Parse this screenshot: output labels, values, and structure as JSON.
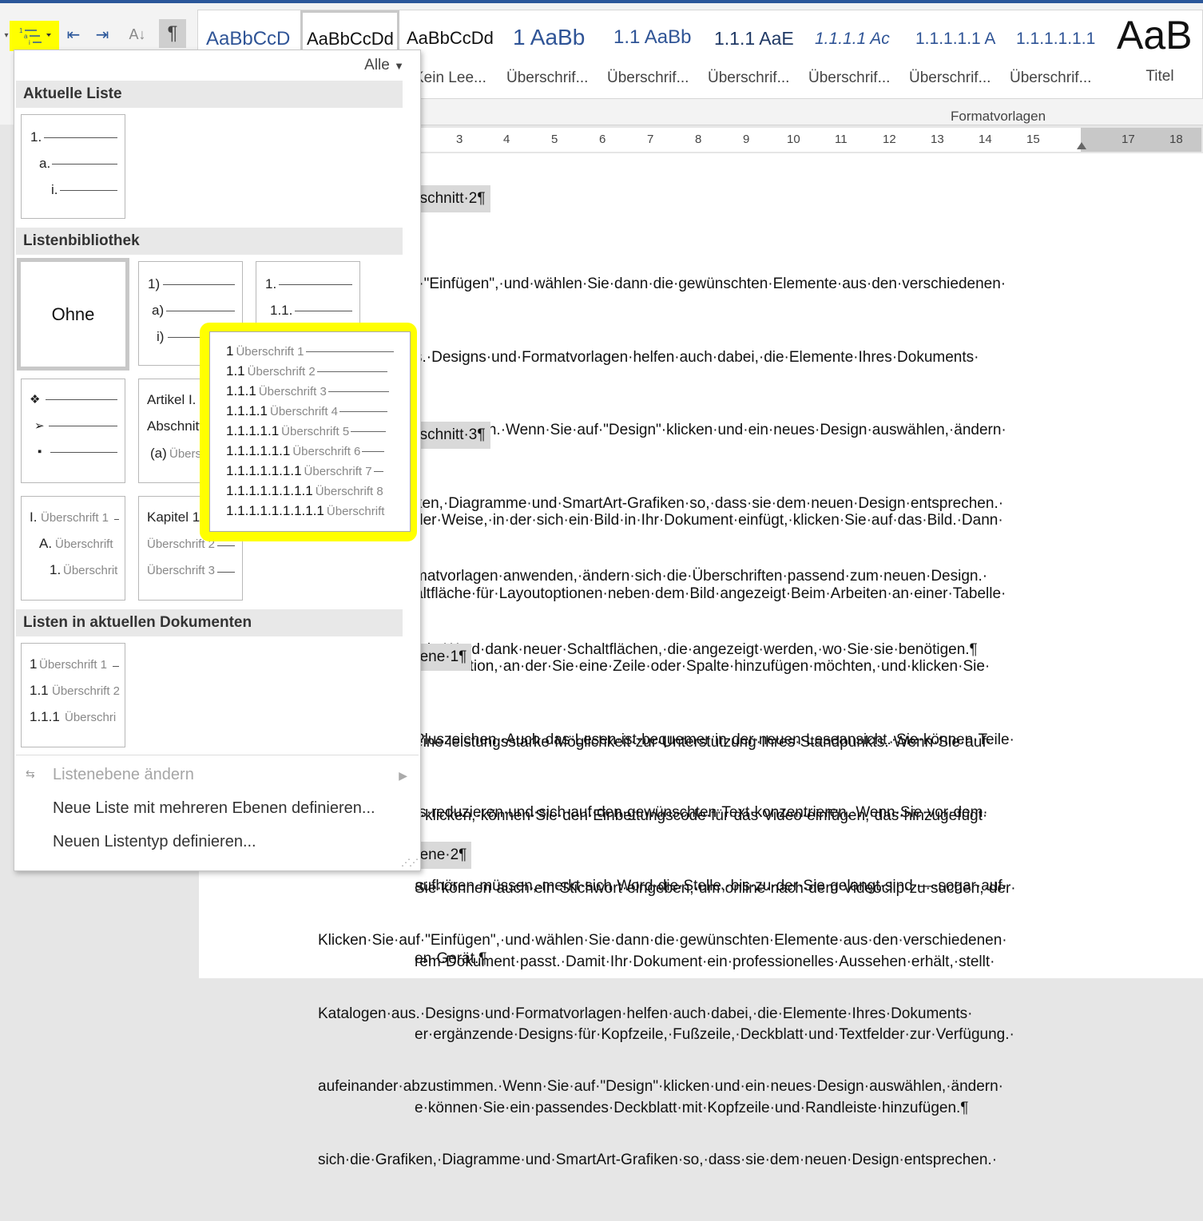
{
  "ribbon": {
    "multilevel_list_icon": "multilevel-list-icon",
    "pilcrow": "¶",
    "styles": [
      {
        "preview": "AaBbCcD",
        "name": ""
      },
      {
        "preview": "AaBbCcDd",
        "name": "Kein Lee..."
      },
      {
        "preview": "AaBbCcDd",
        "name": "Überschrif..."
      },
      {
        "preview": "1  AaBb",
        "name": "Überschrif..."
      },
      {
        "preview": "1.1  AaBb",
        "name": "Überschrif..."
      },
      {
        "preview": "1.1.1  AaE",
        "name": "Überschrif..."
      },
      {
        "preview": "1.1.1.1  Ac",
        "name": "Überschrif..."
      },
      {
        "preview": "1.1.1.1.1  A",
        "name": "Überschrif..."
      },
      {
        "preview": "1.1.1.1.1.1",
        "name": ""
      },
      {
        "preview": "AaB",
        "name": "Titel"
      }
    ],
    "group_label": "Formatvorlagen"
  },
  "ruler": {
    "ticks": [
      "3",
      "4",
      "5",
      "6",
      "7",
      "8",
      "9",
      "10",
      "11",
      "12",
      "13",
      "14",
      "15",
      "17",
      "18"
    ]
  },
  "dropdown": {
    "filter_label": "Alle",
    "sections": {
      "current": "Aktuelle Liste",
      "library": "Listenbibliothek",
      "recent": "Listen in aktuellen Dokumenten"
    },
    "current_list": [
      "1.",
      "a.",
      "i."
    ],
    "library": {
      "none_label": "Ohne",
      "paren": [
        "1)",
        "a)",
        "i)"
      ],
      "decimal": [
        "1.",
        "1.1.",
        "1.1.1."
      ],
      "bullets": [
        "❖",
        "➢",
        "▪"
      ],
      "article": [
        "Artikel I.",
        "Abschnitt",
        "(a)",
        "Übers"
      ],
      "roman_headings": [
        "I.",
        "Überschrift 1",
        "A.",
        "Überschrift",
        "1.",
        "Überschrit"
      ],
      "chapter": [
        "Kapitel 1",
        "Überschrift 2",
        "Überschrift 3"
      ]
    },
    "recent_list": [
      "1",
      "Überschrift 1",
      "1.1",
      "Überschrift 2",
      "1.1.1",
      "Überschri"
    ],
    "menu": {
      "change_level": "Listenebene ändern",
      "define_multilevel": "Neue Liste mit mehreren Ebenen definieren...",
      "define_style": "Neuen Listentyp definieren..."
    }
  },
  "preview_list": [
    {
      "num": "1",
      "label": "Überschrift 1"
    },
    {
      "num": "1.1",
      "label": "Überschrift 2"
    },
    {
      "num": "1.1.1",
      "label": "Überschrift 3"
    },
    {
      "num": "1.1.1.1",
      "label": "Überschrift 4"
    },
    {
      "num": "1.1.1.1.1",
      "label": "Überschrift 5"
    },
    {
      "num": "1.1.1.1.1.1",
      "label": "Überschrift 6"
    },
    {
      "num": "1.1.1.1.1.1.1",
      "label": "Überschrift 7"
    },
    {
      "num": "1.1.1.1.1.1.1.1",
      "label": "Überschrift 8"
    },
    {
      "num": "1.1.1.1.1.1.1.1.1",
      "label": "Überschrift"
    }
  ],
  "document": {
    "h1": "bschnitt·2¶",
    "p1": [
      "f·\"Einfügen\",·und·wählen·Sie·dann·die·gewünschten·Elemente·aus·den·verschiedenen·",
      "s.·Designs·und·Formatvorlagen·helfen·auch·dabei,·die·Elemente·Ihres·Dokuments·",
      "bzustimmen.·Wenn·Sie·auf·\"Design\"·klicken·und·ein·neues·Design·auswählen,·ändern·",
      "ken,·Diagramme·und·SmartArt-Grafiken·so,·dass·sie·dem·neuen·Design·entsprechen.·",
      "matvorlagen·anwenden,·ändern·sich·die·Überschriften·passend·zum·neuen·Design.·",
      "it·in·Word·dank·neuer·Schaltflächen,·die·angezeigt·werden,·wo·Sie·sie·benötigen.¶"
    ],
    "h2": "bschnitt·3¶",
    "p2": [
      "der·Weise,·in·der·sich·ein·Bild·in·Ihr·Dokument·einfügt,·klicken·Sie·auf·das·Bild.·Dann·",
      "altfläche·für·Layoutoptionen·neben·dem·Bild·angezeigt·Beim·Arbeiten·an·einer·Tabelle·",
      "die·Position,·an·der·Sie·eine·Zeile·oder·Spalte·hinzufügen·möchten,·und·klicken·Sie·",
      "Pluszeichen.·Auch·das·Lesen·ist·bequemer·in·der·neuen·Leseansicht.·Sie·können·Teile·",
      "ts·reduzieren·und·sich·auf·den·gewünschten·Text·konzentrieren.·Wenn·Sie·vor·dem·",
      "aufhören·müssen,·merkt·sich·Word·die·Stelle,·bis·zu·der·Sie·gelangt·sind·—·sogar·auf·",
      "en·Gerät.¶"
    ],
    "h3": "bene·1¶",
    "p3": [
      "eine·leistungsstarke·Möglichkeit·zur·Unterstützung·Ihres·Standpunkts.·Wenn·Sie·auf·",
      "\"·klicken,·können·Sie·den·Einbettungscode·für·das·Video·einfügen,·das·hinzugefügt·",
      "Sie·können·auch·ein·Stichwort·eingeben,·um·online·nach·dem·Videoclip·zu·suchen,·der·",
      "rem·Dokument·passt.·Damit·Ihr·Dokument·ein·professionelles·Aussehen·erhält,·stellt·",
      "er·ergänzende·Designs·für·Kopfzeile,·Fußzeile,·Deckblatt·und·Textfelder·zur·Verfügung.·",
      "e·können·Sie·ein·passendes·Deckblatt·mit·Kopfzeile·und·Randleiste·hinzufügen.¶"
    ],
    "h4": "bene·2¶",
    "p4": [
      "Klicken·Sie·auf·\"Einfügen\",·und·wählen·Sie·dann·die·gewünschten·Elemente·aus·den·verschiedenen·",
      "Katalogen·aus.·Designs·und·Formatvorlagen·helfen·auch·dabei,·die·Elemente·Ihres·Dokuments·",
      "aufeinander·abzustimmen.·Wenn·Sie·auf·\"Design\"·klicken·und·ein·neues·Design·auswählen,·ändern·",
      "sich·die·Grafiken,·Diagramme·und·SmartArt-Grafiken·so,·dass·sie·dem·neuen·Design·entsprechen.·"
    ]
  }
}
